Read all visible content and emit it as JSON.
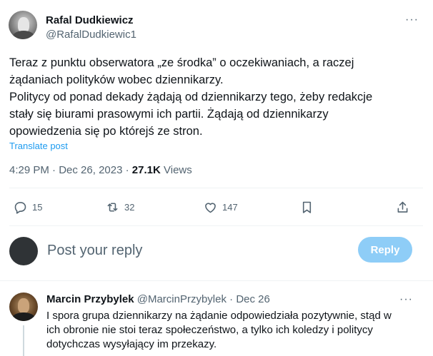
{
  "tweet": {
    "author_name": "Rafal Dudkiewicz",
    "author_handle": "@RafalDudkiewic1",
    "more_label": "···",
    "text_lines": [
      "Teraz z punktu obserwatora „ze środka” o oczekiwaniach, a raczej",
      "żądaniach polityków wobec dziennikarzy.",
      "Politycy od ponad dekady żądają od dziennikarzy tego, żeby redakcje",
      "stały się biurami prasowymi ich partii. Żądają od dziennikarzy",
      "opowiedzenia się po którejś ze stron."
    ],
    "translate_label": "Translate post",
    "time": "4:29 PM",
    "date": "Dec 26, 2023",
    "views_count": "27.1K",
    "views_label": "Views"
  },
  "actions": {
    "replies": {
      "icon": "reply-icon",
      "count": "15"
    },
    "reposts": {
      "icon": "repost-icon",
      "count": "32"
    },
    "likes": {
      "icon": "like-icon",
      "count": "147"
    },
    "bookmark": {
      "icon": "bookmark-icon"
    },
    "share": {
      "icon": "share-icon"
    }
  },
  "composer": {
    "placeholder": "Post your reply",
    "reply_button": "Reply"
  },
  "reply": {
    "author_name": "Marcin Przybylek",
    "author_handle": "@MarcinPrzybylek",
    "date": "Dec 26",
    "more_label": "···",
    "text_lines": [
      "I spora grupa dziennikarzy na żądanie odpowiedziała pozytywnie, stąd w",
      "ich obronie nie stoi teraz społeczeństwo, a tylko ich koledzy i politycy",
      "dotychczas wysyłający im przekazy."
    ]
  },
  "colors": {
    "text": "#0f1419",
    "secondary": "#536471",
    "link": "#1d9bf0",
    "reply_button_disabled": "#8ecdf7",
    "divider": "#eff3f4"
  }
}
